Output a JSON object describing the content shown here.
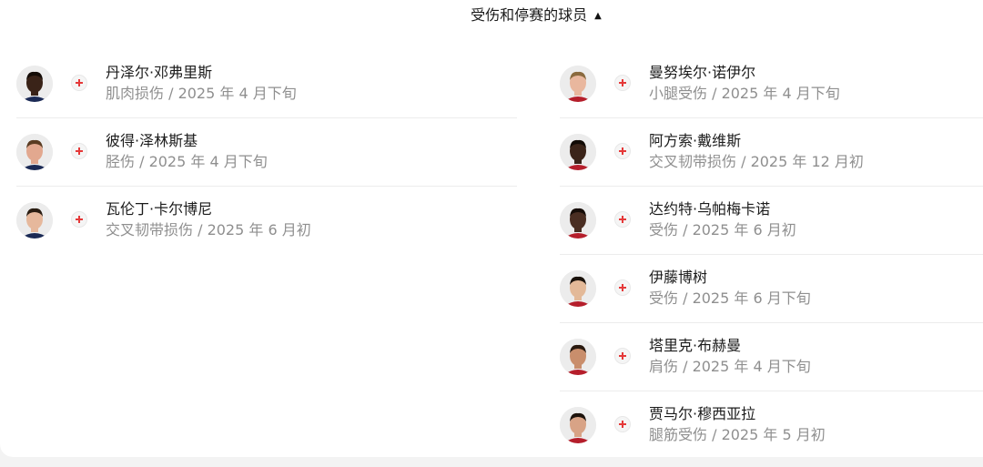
{
  "header": {
    "title": "受伤和停赛的球员",
    "caret_icon": "caret-up-icon"
  },
  "left_players": [
    {
      "name": "丹泽尔·邓弗里斯",
      "detail": "肌肉损伤 / 2025 年 4 月下旬",
      "skin": "#3a2318",
      "hair": "#140c07",
      "shirt": "#1b2a55"
    },
    {
      "name": "彼得·泽林斯基",
      "detail": "胫伤 / 2025 年 4 月下旬",
      "skin": "#e2a88f",
      "hair": "#5a3c22",
      "shirt": "#1b2a55"
    },
    {
      "name": "瓦伦丁·卡尔博尼",
      "detail": "交叉韧带损伤 / 2025 年 6 月初",
      "skin": "#e6b89c",
      "hair": "#2a1d12",
      "shirt": "#1b2a55"
    }
  ],
  "right_players": [
    {
      "name": "曼努埃尔·诺伊尔",
      "detail": "小腿受伤 / 2025 年 4 月下旬",
      "skin": "#e9b79e",
      "hair": "#8a6a3e",
      "shirt": "#b51e2b"
    },
    {
      "name": "阿方索·戴维斯",
      "detail": "交叉韧带损伤 / 2025 年 12 月初",
      "skin": "#3b2419",
      "hair": "#120b06",
      "shirt": "#b51e2b"
    },
    {
      "name": "达约特·乌帕梅卡诺",
      "detail": "受伤 / 2025 年 6 月初",
      "skin": "#4a2e22",
      "hair": "#160d08",
      "shirt": "#b51e2b"
    },
    {
      "name": "伊藤博树",
      "detail": "受伤 / 2025 年 6 月下旬",
      "skin": "#e3b998",
      "hair": "#1a120b",
      "shirt": "#b51e2b"
    },
    {
      "name": "塔里克·布赫曼",
      "detail": "肩伤 / 2025 年 4 月下旬",
      "skin": "#c98e6c",
      "hair": "#2a1a10",
      "shirt": "#b51e2b"
    },
    {
      "name": "贾马尔·穆西亚拉",
      "detail": "腿筋受伤 / 2025 年 5 月初",
      "skin": "#d8a386",
      "hair": "#1d130c",
      "shirt": "#b51e2b"
    }
  ],
  "injury_icon": "red-cross-icon"
}
